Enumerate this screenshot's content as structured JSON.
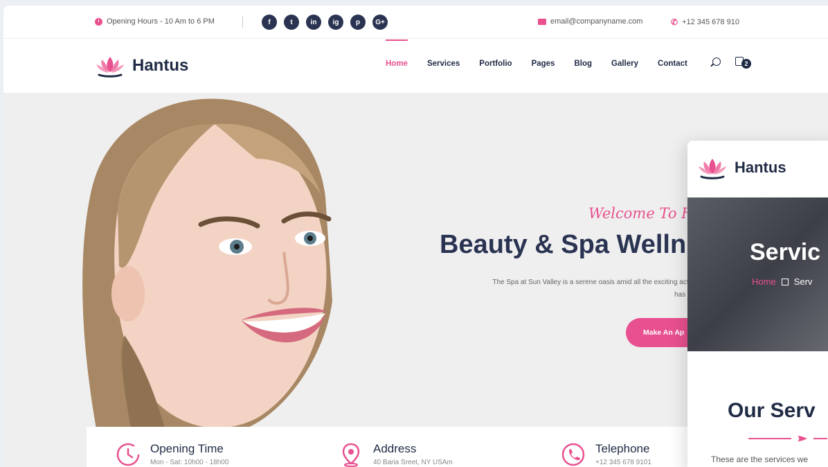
{
  "topbar": {
    "hours": "Opening Hours - 10 Am to 6 PM",
    "socials": [
      "f",
      "t",
      "in",
      "ig",
      "p",
      "G+"
    ],
    "email": "email@companyname.com",
    "phone": "+12 345 678 910"
  },
  "brand": {
    "name": "Hantus"
  },
  "nav": {
    "items": [
      "Home",
      "Services",
      "Portfolio",
      "Pages",
      "Blog",
      "Gallery",
      "Contact"
    ],
    "active": "Home",
    "cart_count": "2"
  },
  "hero": {
    "welcome": "Welcome To Ha",
    "title": "Beauty & Spa Welln",
    "description_line1": "The Spa at Sun Valley is a serene oasis amid all the exciting activities o",
    "description_line2": "has delivere",
    "cta": "Make An Ap"
  },
  "info": [
    {
      "title": "Opening Time",
      "sub": "Mon - Sat: 10h00 - 18h00",
      "icon": "clock-icon"
    },
    {
      "title": "Address",
      "sub": "40 Baria Sreet, NY USAm",
      "icon": "map-pin-icon"
    },
    {
      "title": "Telephone",
      "sub": "+12 345 678 9101",
      "icon": "phone-icon"
    }
  ],
  "overlay": {
    "brand": "Hantus",
    "banner_title": "Servic",
    "crumb_home": "Home",
    "crumb_current": "Serv",
    "section_title": "Our Serv",
    "section_desc": "These are the services we"
  },
  "colors": {
    "accent": "#e8508f",
    "dark": "#1f2a44"
  }
}
